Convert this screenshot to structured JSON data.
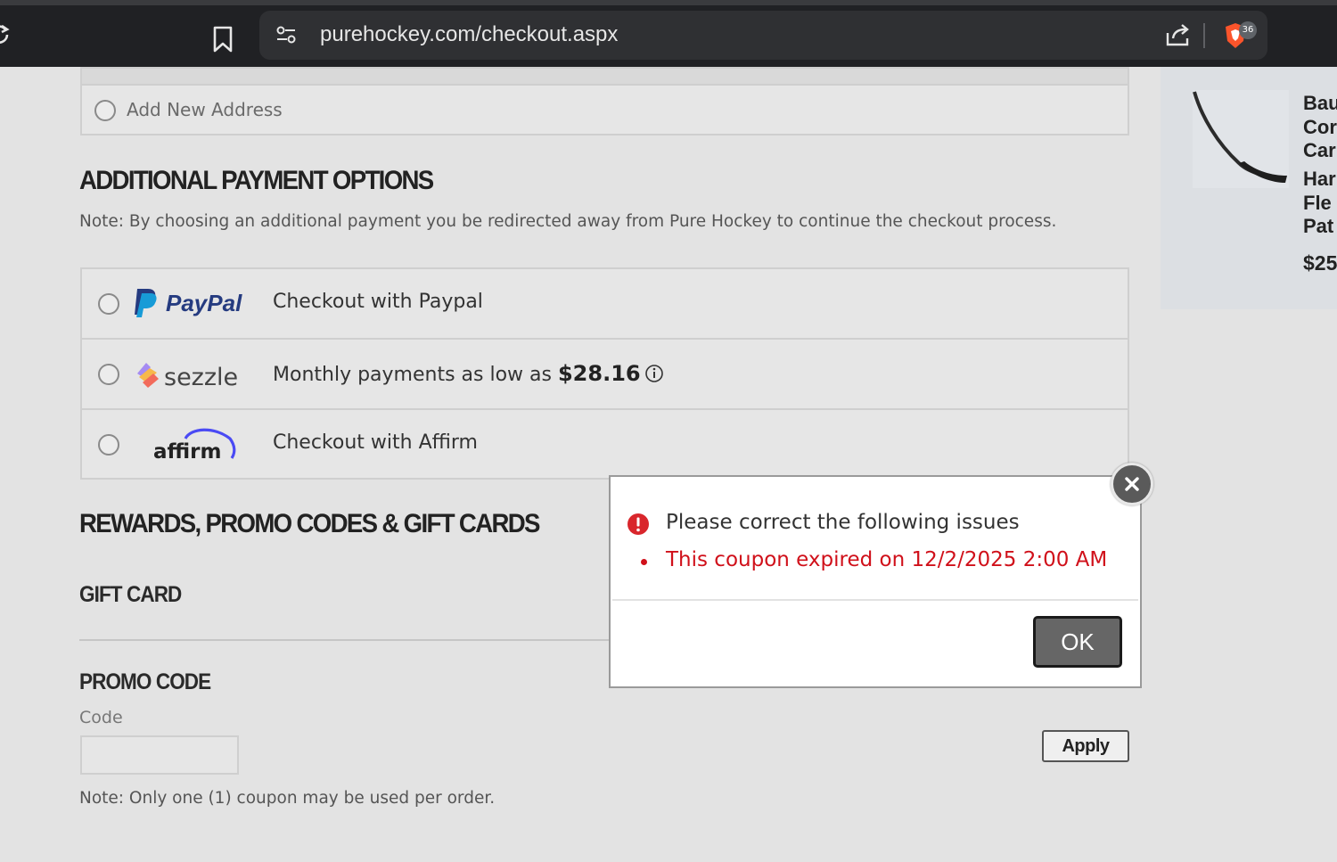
{
  "browser": {
    "url": "purehockey.com/checkout.aspx",
    "brave_badge_count": "36",
    "icons": [
      "reload-icon",
      "bookmark-icon",
      "site-settings-icon",
      "share-icon",
      "brave-shield-icon"
    ]
  },
  "address": {
    "add_new_label": "Add New Address"
  },
  "payment_options": {
    "heading": "ADDITIONAL PAYMENT OPTIONS",
    "note": "Note: By choosing an additional payment you be redirected away from Pure Hockey to continue the checkout process.",
    "options": [
      {
        "brand": "PayPal",
        "label": "Checkout with Paypal"
      },
      {
        "brand": "sezzle",
        "label_prefix": "Monthly payments as low as",
        "amount": "$28.16"
      },
      {
        "brand": "affirm",
        "label": "Checkout with Affirm"
      }
    ]
  },
  "rewards": {
    "heading": "REWARDS, PROMO CODES & GIFT CARDS",
    "gift_card_heading": "GIFT CARD",
    "promo_code_heading": "PROMO CODE",
    "code_label": "Code",
    "code_value": "",
    "apply_label": "Apply",
    "coupon_note": "Note: Only one (1) coupon may be used per order."
  },
  "cart": {
    "item_name_lines": "Bau\nCor\nCar",
    "item_desc_lines": "Har\nFle\nPat",
    "item_price": "$25"
  },
  "modal": {
    "title": "Please correct the following issues",
    "errors": [
      "This coupon expired on 12/2/2025 2:00 AM"
    ],
    "ok_label": "OK"
  },
  "colors": {
    "error_red": "#d0101a",
    "paypal_dark": "#253b80",
    "paypal_light": "#179bd7",
    "affirm_blue": "#4a4af4"
  }
}
